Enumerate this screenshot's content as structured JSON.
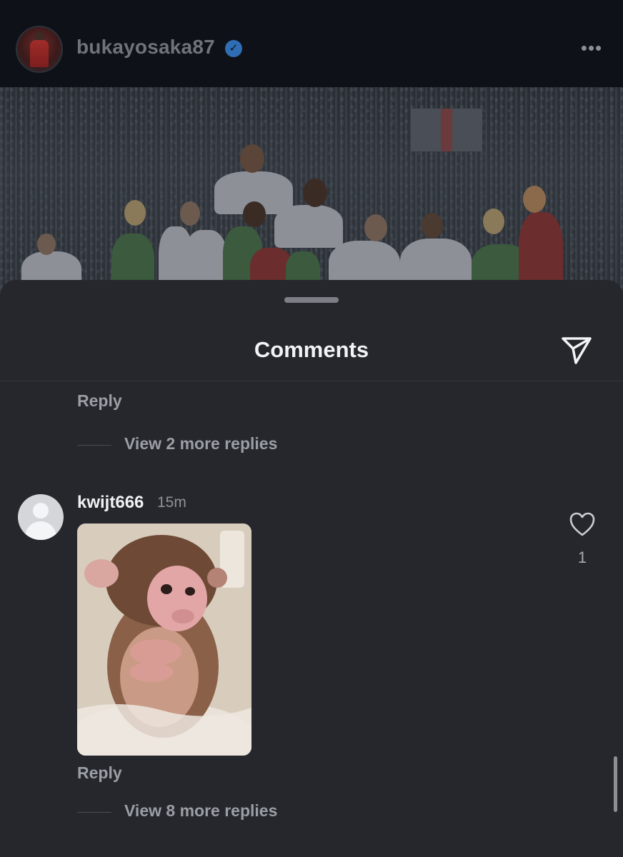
{
  "post": {
    "username": "bukayosaka87",
    "verified_icon": "verified-badge-icon",
    "more_icon": "more-dots-icon"
  },
  "sheet": {
    "title": "Comments",
    "share_icon": "send-icon"
  },
  "thread_top": {
    "reply_label": "Reply",
    "view_replies_label": "View 2 more replies"
  },
  "comment": {
    "username": "kwijt666",
    "time": "15m",
    "likes": "1",
    "reply_label": "Reply",
    "view_replies_label": "View 8 more replies"
  },
  "colors": {
    "sheet_bg": "#25272c",
    "header_bg": "#0e1218",
    "muted_text": "#9a9ea5",
    "verified": "#2f6db4"
  }
}
